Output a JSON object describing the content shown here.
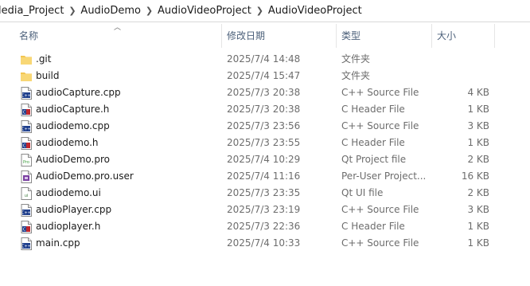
{
  "breadcrumb": [
    "ledia_Project",
    "AudioDemo",
    "AudioVideoProject",
    "AudioVideoProject"
  ],
  "columns": {
    "name": "名称",
    "date": "修改日期",
    "type": "类型",
    "size": "大小"
  },
  "files": [
    {
      "name": ".git",
      "date": "2025/7/4 14:48",
      "type": "文件夹",
      "size": "",
      "icon": "folder-icon"
    },
    {
      "name": "build",
      "date": "2025/7/4 15:47",
      "type": "文件夹",
      "size": "",
      "icon": "folder-icon"
    },
    {
      "name": "audioCapture.cpp",
      "date": "2025/7/3 20:38",
      "type": "C++ Source File",
      "size": "4 KB",
      "icon": "cpp-file-icon"
    },
    {
      "name": "audioCapture.h",
      "date": "2025/7/3 20:38",
      "type": "C Header File",
      "size": "1 KB",
      "icon": "header-file-icon"
    },
    {
      "name": "audiodemo.cpp",
      "date": "2025/7/3 23:56",
      "type": "C++ Source File",
      "size": "3 KB",
      "icon": "cpp-file-icon"
    },
    {
      "name": "audiodemo.h",
      "date": "2025/7/3 23:55",
      "type": "C Header File",
      "size": "1 KB",
      "icon": "header-file-icon"
    },
    {
      "name": "AudioDemo.pro",
      "date": "2025/7/4 10:29",
      "type": "Qt Project file",
      "size": "2 KB",
      "icon": "pro-file-icon"
    },
    {
      "name": "AudioDemo.pro.user",
      "date": "2025/7/4 11:16",
      "type": "Per-User Project...",
      "size": "16 KB",
      "icon": "user-file-icon"
    },
    {
      "name": "audiodemo.ui",
      "date": "2025/7/3 23:35",
      "type": "Qt UI file",
      "size": "2 KB",
      "icon": "ui-file-icon"
    },
    {
      "name": "audioPlayer.cpp",
      "date": "2025/7/3 23:19",
      "type": "C++ Source File",
      "size": "3 KB",
      "icon": "cpp-file-icon"
    },
    {
      "name": "audioplayer.h",
      "date": "2025/7/3 22:36",
      "type": "C Header File",
      "size": "1 KB",
      "icon": "header-file-icon"
    },
    {
      "name": "main.cpp",
      "date": "2025/7/4 10:33",
      "type": "C++ Source File",
      "size": "1 KB",
      "icon": "cpp-file-icon"
    }
  ],
  "colors": {
    "folder": "#f3c551",
    "cpp_badge": "#1f3f8c",
    "header_badge": "#c1272d",
    "header_text": "#4c607a"
  }
}
